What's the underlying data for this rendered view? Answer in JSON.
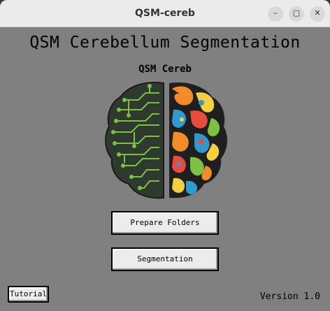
{
  "window": {
    "title": "QSM-cereb",
    "controls": [
      "minimize-icon",
      "maximize-icon",
      "close-icon"
    ],
    "minimize_glyph": "–",
    "maximize_glyph": "▢",
    "close_glyph": "✕"
  },
  "main": {
    "heading": "QSM Cerebellum Segmentation",
    "logo_caption": "QSM Cereb",
    "buttons": {
      "prepare": "Prepare Folders",
      "segmentation": "Segmentation",
      "tutorial": "Tutorial"
    },
    "version": "Version 1.0"
  },
  "colors": {
    "background": "#808080",
    "titlebar": "#ebebeb",
    "circuit_green": "#7cc242",
    "circuit_dark": "#2f3a2f"
  }
}
